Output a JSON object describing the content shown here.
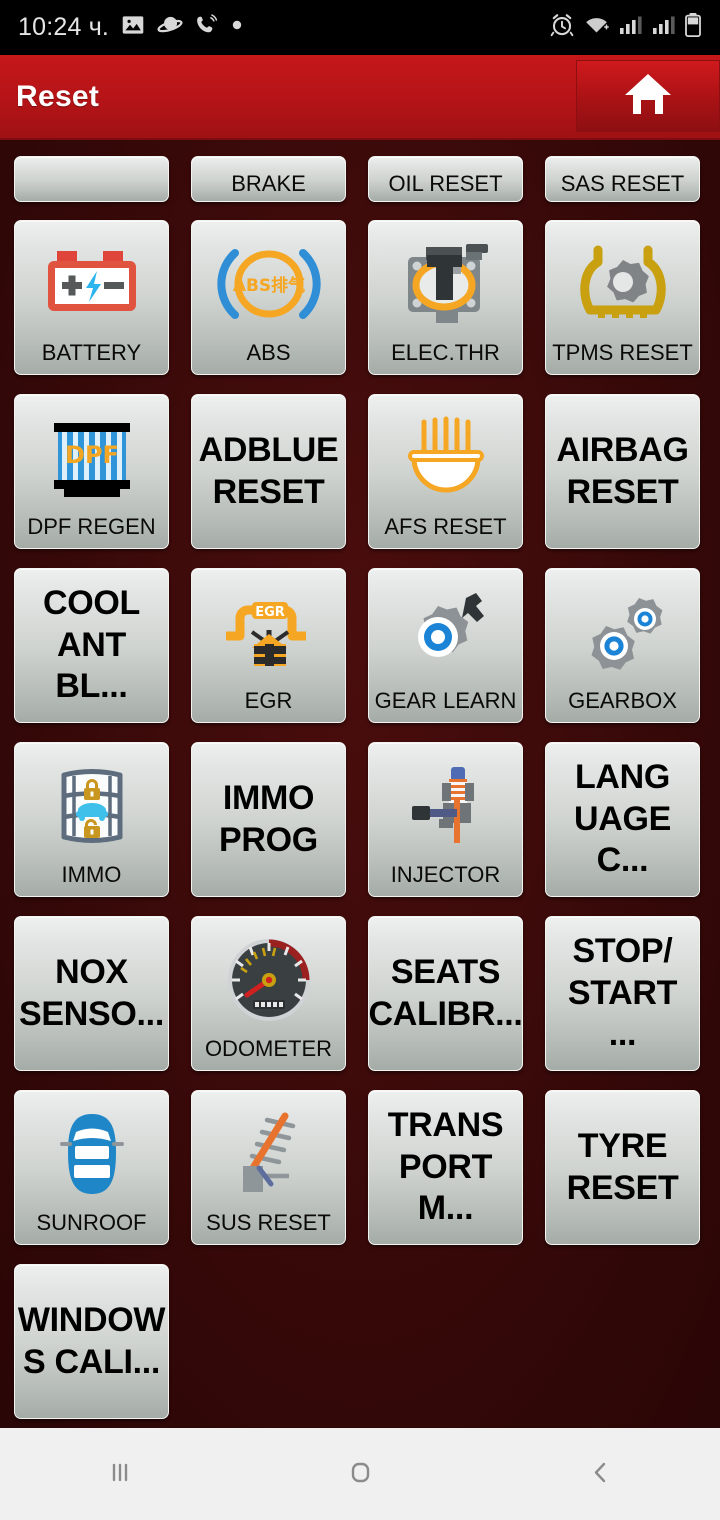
{
  "status_bar": {
    "time": "10:24 ч.",
    "left_icons": [
      "gallery-icon",
      "planet-icon",
      "call-icon",
      "dot-icon"
    ],
    "right_icons": [
      "alarm-icon",
      "wifi-icon",
      "signal-1-icon",
      "signal-2-icon",
      "battery-icon"
    ]
  },
  "header": {
    "title": "Reset",
    "home_button_icon": "home-icon",
    "bg_color": "#b51417"
  },
  "grid": {
    "rows": [
      [
        {
          "label": "",
          "icon": "none",
          "style": "clipped"
        },
        {
          "label": "BRAKE",
          "icon": "none",
          "style": "clipped"
        },
        {
          "label": "OIL RESET",
          "icon": "none",
          "style": "clipped"
        },
        {
          "label": "SAS RESET",
          "icon": "none",
          "style": "clipped"
        }
      ],
      [
        {
          "label": "BATTERY",
          "icon": "battery-icon",
          "style": "icon"
        },
        {
          "label": "ABS",
          "icon": "abs-bleed-icon",
          "style": "icon"
        },
        {
          "label": "ELEC.THR",
          "icon": "throttle-body-icon",
          "style": "icon"
        },
        {
          "label": "TPMS RESET",
          "icon": "tpms-icon",
          "style": "icon"
        }
      ],
      [
        {
          "label": "DPF REGEN",
          "icon": "dpf-filter-icon",
          "style": "icon"
        },
        {
          "label": "ADBLUE RESET",
          "icon": "none",
          "style": "text",
          "text_lines": [
            "ADBLUE",
            "RESET"
          ]
        },
        {
          "label": "AFS RESET",
          "icon": "afs-headlamp-icon",
          "style": "icon"
        },
        {
          "label": "AIRBAG RESET",
          "icon": "none",
          "style": "text",
          "text_lines": [
            "AIRBAG",
            "RESET"
          ]
        }
      ],
      [
        {
          "label": "COOLANT BLEED",
          "icon": "none",
          "style": "text",
          "text_lines": [
            "COOL",
            "ANT BL..."
          ]
        },
        {
          "label": "EGR",
          "icon": "egr-valve-icon",
          "style": "icon"
        },
        {
          "label": "GEAR LEARN",
          "icon": "gear-learn-icon",
          "style": "icon"
        },
        {
          "label": "GEARBOX",
          "icon": "gearbox-icon",
          "style": "icon"
        }
      ],
      [
        {
          "label": "IMMO",
          "icon": "immo-lock-icon",
          "style": "icon"
        },
        {
          "label": "IMMO PROG",
          "icon": "none",
          "style": "text",
          "text_lines": [
            "IMMO",
            "PROG"
          ]
        },
        {
          "label": "INJECTOR",
          "icon": "injector-icon",
          "style": "icon"
        },
        {
          "label": "LANGUAGE CHANGE",
          "icon": "none",
          "style": "text",
          "text_lines": [
            "LANG",
            "UAGE C..."
          ]
        }
      ],
      [
        {
          "label": "NOX SENSOR",
          "icon": "none",
          "style": "text",
          "text_lines": [
            "NOX",
            "SENSO..."
          ]
        },
        {
          "label": "ODOMETER",
          "icon": "odometer-icon",
          "style": "icon"
        },
        {
          "label": "SEATS CALIBRATION",
          "icon": "none",
          "style": "text",
          "text_lines": [
            "SEATS",
            "CALIBR..."
          ]
        },
        {
          "label": "STOP/START",
          "icon": "none",
          "style": "text",
          "text_lines": [
            "STOP/",
            "START ..."
          ]
        }
      ],
      [
        {
          "label": "SUNROOF",
          "icon": "sunroof-icon",
          "style": "icon"
        },
        {
          "label": "SUS RESET",
          "icon": "suspension-icon",
          "style": "icon"
        },
        {
          "label": "TRANSPORT MODE",
          "icon": "none",
          "style": "text",
          "text_lines": [
            "TRANS",
            "PORT M..."
          ]
        },
        {
          "label": "TYRE RESET",
          "icon": "none",
          "style": "text",
          "text_lines": [
            "TYRE",
            "RESET"
          ]
        }
      ],
      [
        {
          "label": "WINDOWS CALIBRATION",
          "icon": "none",
          "style": "text",
          "text_lines": [
            "WINDOW",
            "S  CALI..."
          ]
        }
      ]
    ],
    "background_color": "#3d0a0a"
  },
  "nav_bar": {
    "buttons": [
      {
        "name": "recents-button",
        "icon": "recents-icon"
      },
      {
        "name": "home-button",
        "icon": "home-square-icon"
      },
      {
        "name": "back-button",
        "icon": "back-chevron-icon"
      }
    ],
    "bg_color": "#f0f0f0"
  },
  "icon_labels": {
    "abs_text": "ABS排气",
    "dpf_text": "DPF",
    "egr_text": "EGR"
  }
}
